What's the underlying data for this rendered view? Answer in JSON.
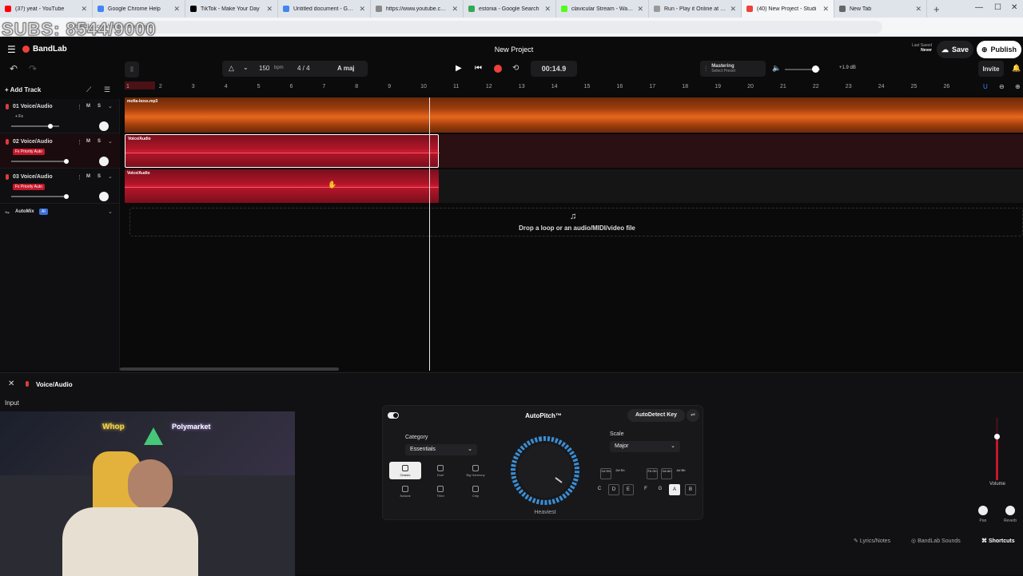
{
  "browser": {
    "tabs": [
      {
        "title": "(37) yeat - YouTube",
        "color": "#ff0000"
      },
      {
        "title": "Google Chrome Help",
        "color": "#4285f4"
      },
      {
        "title": "TikTok - Make Your Day",
        "color": "#000000"
      },
      {
        "title": "Untitled document - Google",
        "color": "#4285f4"
      },
      {
        "title": "https://www.youtube.com/...",
        "color": "#888888"
      },
      {
        "title": "estonia - Google Search",
        "color": "#34a853"
      },
      {
        "title": "clavicular Stream - Watch Li",
        "color": "#53fc18"
      },
      {
        "title": "Run - Play it Online at Cool",
        "color": "#999999"
      },
      {
        "title": "(40) New Project - Studi",
        "color": "#f0403a"
      },
      {
        "title": "New Tab",
        "color": "#666666"
      }
    ],
    "url": "bandlab.com/studio/new project",
    "watermark": "SUBS: 8544/9000"
  },
  "header": {
    "brand": "BandLab",
    "project_title": "New Project",
    "last_saved_label": "Last Saved",
    "last_saved_value": "Never",
    "save_label": "Save",
    "publish_label": "Publish"
  },
  "toolbar": {
    "bpm": "150",
    "bpm_unit": "bpm",
    "time_sig": "4 / 4",
    "key": "A maj",
    "time": "00:14.9",
    "mastering_label": "Mastering",
    "mastering_preset": "Select Preset",
    "volume_db": "+1.9 dB",
    "invite_label": "Invite",
    "add_track_label": "Add Track"
  },
  "tracks": [
    {
      "name": "01  Voice/Audio",
      "fx": "+ Fx",
      "fx_active": false
    },
    {
      "name": "02  Voice/Audio",
      "fx": "Fx Priority Auto",
      "fx_active": true
    },
    {
      "name": "03  Voice/Audio",
      "fx": "Fx Priority Auto",
      "fx_active": true
    }
  ],
  "automix_label": "AutoMix",
  "automix_badge": "AI",
  "ruler_ticks": [
    "1",
    "2",
    "3",
    "4",
    "5",
    "6",
    "7",
    "8",
    "9",
    "10",
    "11",
    "12",
    "13",
    "14",
    "15",
    "16",
    "17",
    "18",
    "19",
    "20",
    "21",
    "22",
    "23",
    "24",
    "25",
    "26"
  ],
  "clips": {
    "track1": "mofia-boss.mp3",
    "track2": "Voice/Audio",
    "track3": "Voice/Audio"
  },
  "dropzone_text": "Drop a loop or an audio/MIDI/video file",
  "editor": {
    "title": "Voice/Audio",
    "input_label": "Input",
    "autopitch_title": "AutoPitch™",
    "autodetect_label": "AutoDetect Key",
    "category_label": "Category",
    "category_value": "Essentials",
    "modes": [
      "Classic",
      "Duet",
      "Big Harmony",
      "Natural",
      "Third",
      "Chip"
    ],
    "dial_label": "Heaviest",
    "scale_label": "Scale",
    "scale_value": "Major",
    "sharps": [
      "C# Db",
      "D# Eb",
      "F# Gb",
      "G# Ab",
      "A# Bb"
    ],
    "naturals": [
      "C",
      "D",
      "E",
      "F",
      "G",
      "A",
      "B"
    ],
    "volume_label": "Volume",
    "pan_label": "Pan",
    "reverb_label": "Reverb",
    "lyrics_label": "Lyrics/Notes",
    "sounds_label": "BandLab Sounds",
    "shortcuts_label": "Shortcuts"
  },
  "webcam": {
    "sign1": "Whop",
    "sign2": "Polymarket"
  },
  "colors": {
    "accent": "#f0403a",
    "track1": "#e8661c",
    "track2": "#c4182a"
  }
}
